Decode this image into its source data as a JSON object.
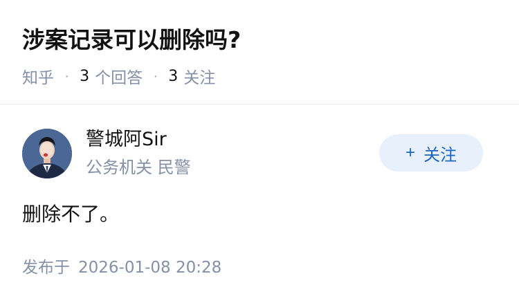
{
  "question": {
    "title": "涉案记录可以删除吗?",
    "source": "知乎",
    "separator": "·",
    "answers_count": "3",
    "answers_label": "个回答",
    "followers_count": "3",
    "followers_label": "关注"
  },
  "answer": {
    "author_name": "警城阿Sir",
    "author_badge": "公务机关 民警",
    "follow_label": "关注",
    "follow_icon": "+",
    "content": "删除不了。",
    "published_label": "发布于",
    "published_time": "2026-01-08 20:28"
  },
  "colors": {
    "text_primary": "#121212",
    "text_secondary": "#8590a6",
    "accent": "#1a65c4",
    "follow_bg": "#e8f1fb"
  }
}
